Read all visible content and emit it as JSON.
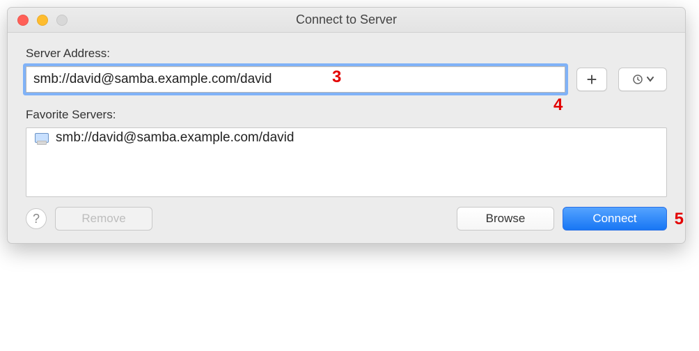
{
  "window": {
    "title": "Connect to Server"
  },
  "labels": {
    "server_address": "Server Address:",
    "favorite_servers": "Favorite Servers:"
  },
  "address": {
    "value": "smb://david@samba.example.com/david"
  },
  "favorites": {
    "items": [
      {
        "label": "smb://david@samba.example.com/david"
      }
    ]
  },
  "buttons": {
    "help": "?",
    "remove": "Remove",
    "browse": "Browse",
    "connect": "Connect"
  },
  "annotations": {
    "a3": "3",
    "a4": "4",
    "a5": "5"
  }
}
